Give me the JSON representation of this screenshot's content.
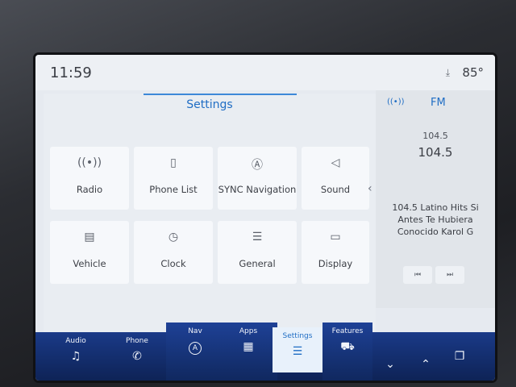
{
  "status": {
    "time": "11:59",
    "temperature": "85°",
    "icon": "signal-icon"
  },
  "settings": {
    "title": "Settings",
    "tiles": [
      {
        "label": "Radio",
        "icon": "radio-icon",
        "glyph": "((•))"
      },
      {
        "label": "Phone List",
        "icon": "phone-list-icon",
        "glyph": "▯"
      },
      {
        "label": "SYNC Navigation",
        "icon": "navigation-icon",
        "glyph": "Ⓐ"
      },
      {
        "label": "Sound",
        "icon": "speaker-icon",
        "glyph": "◁"
      },
      {
        "label": "Vehicle",
        "icon": "vehicle-icon",
        "glyph": "▤"
      },
      {
        "label": "Clock",
        "icon": "clock-icon",
        "glyph": "◷"
      },
      {
        "label": "General",
        "icon": "sliders-icon",
        "glyph": "☰"
      },
      {
        "label": "Display",
        "icon": "display-icon",
        "glyph": "▭"
      }
    ],
    "page_count": 2,
    "current_page": 1
  },
  "radio": {
    "band": "FM",
    "freq_small": "104.5",
    "freq_large": "104.5",
    "rds_line1": "104.5 Latino Hits Si",
    "rds_line2": "Antes Te Hubiera",
    "rds_line3": "Conocido Karol G",
    "seek_back": "⏮",
    "seek_forward": "⏭"
  },
  "nav": [
    {
      "label": "Audio",
      "icon": "music-note-icon",
      "glyph": "♫"
    },
    {
      "label": "Phone",
      "icon": "phone-icon",
      "glyph": "✆"
    },
    {
      "label": "Nav",
      "icon": "nav-icon",
      "glyph": "A"
    },
    {
      "label": "Apps",
      "icon": "apps-grid-icon",
      "glyph": "▦"
    },
    {
      "label": "Settings",
      "icon": "settings-sliders-icon",
      "glyph": "☰"
    },
    {
      "label": "Features",
      "icon": "truck-icon",
      "glyph": "⛟"
    }
  ],
  "controls": {
    "down": "⌄",
    "up": "⌃",
    "copy": "❐"
  }
}
